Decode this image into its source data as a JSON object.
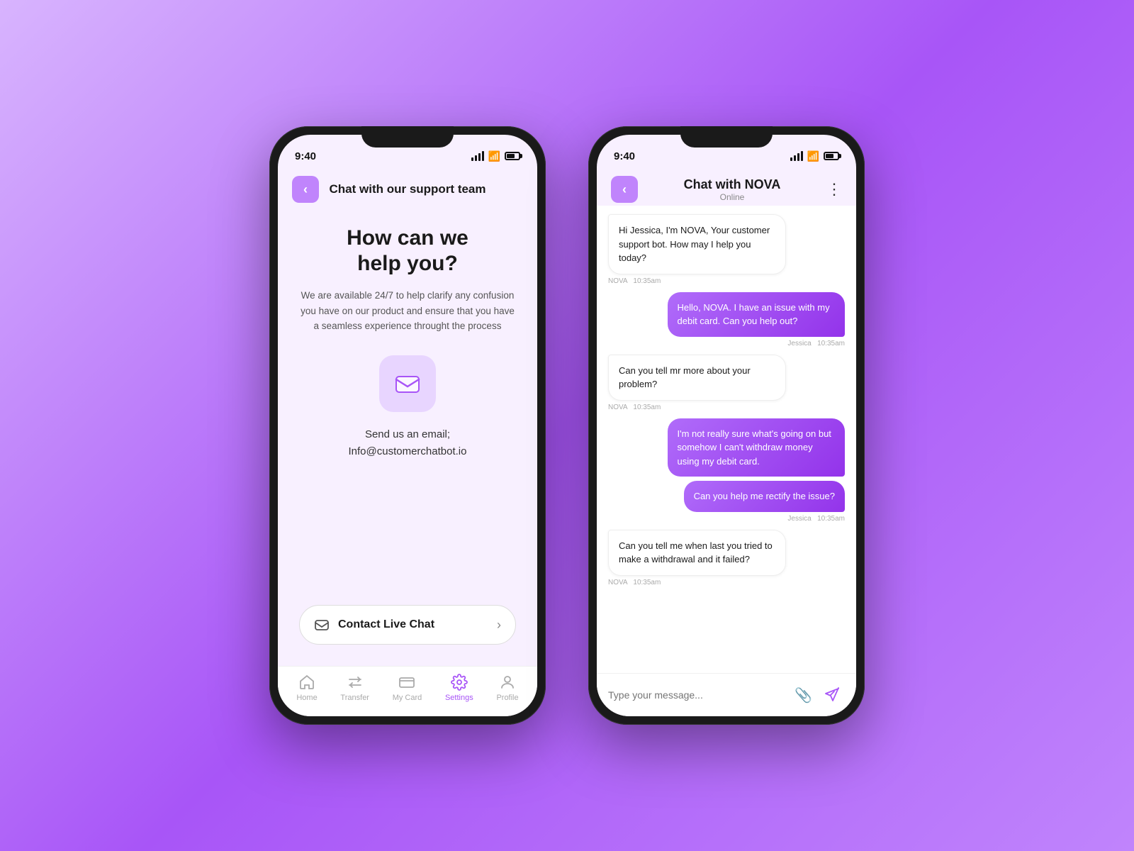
{
  "background": "#a855f7",
  "phone1": {
    "status_time": "9:40",
    "header_title": "Chat with our support team",
    "back_label": "<",
    "help_title": "How can we\nhelp you?",
    "help_desc": "We are available 24/7 to help clarify any confusion you have on our product and ensure that  you have a seamless experience throught the process",
    "email_send_text": "Send us an email;",
    "email_address": "Info@customerchatbot.io",
    "contact_chat_label": "Contact Live Chat",
    "nav": {
      "items": [
        {
          "label": "Home",
          "icon": "🏠",
          "active": false
        },
        {
          "label": "Transfer",
          "icon": "⇄",
          "active": false
        },
        {
          "label": "My Card",
          "icon": "💳",
          "active": false
        },
        {
          "label": "Settings",
          "icon": "⚙️",
          "active": true
        },
        {
          "label": "Profile",
          "icon": "👤",
          "active": false
        }
      ]
    }
  },
  "phone2": {
    "status_time": "9:40",
    "header_title": "Chat with NOVA",
    "online_status": "Online",
    "messages": [
      {
        "type": "bot",
        "text": "Hi Jessica,  I'm NOVA, Your customer support bot. How may I help you today?",
        "sender": "NOVA",
        "time": "10:35am"
      },
      {
        "type": "user",
        "text": "Hello, NOVA. I have an issue with my debit card. Can you help out?",
        "sender": "Jessica",
        "time": "10:35am"
      },
      {
        "type": "bot",
        "text": "Can you tell mr more about your problem?",
        "sender": "NOVA",
        "time": "10:35am"
      },
      {
        "type": "user_multi",
        "bubbles": [
          "I'm not really sure what's going on but somehow I can't withdraw money using my debit card.",
          "Can you help me rectify the issue?"
        ],
        "sender": "Jessica",
        "time": "10:35am"
      },
      {
        "type": "bot",
        "text": "Can you tell me when last you tried to make a withdrawal and it failed?",
        "sender": "NOVA",
        "time": "10:35am"
      }
    ],
    "input_placeholder": "Type your message..."
  }
}
